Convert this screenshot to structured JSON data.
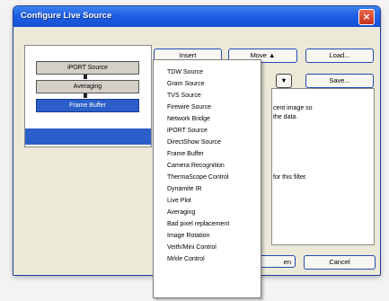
{
  "window": {
    "title": "Configure Live Source",
    "close_label": "×"
  },
  "chain": [
    {
      "label": "iPORT Source",
      "selected": false
    },
    {
      "label": "Averaging",
      "selected": false
    },
    {
      "label": "Frame Buffer",
      "selected": true
    }
  ],
  "buttons": {
    "insert": "Insert",
    "move_up": "Move ▲",
    "load": "Load...",
    "move_down": "▼",
    "save": "Save...",
    "open": "en",
    "cancel": "Cancel"
  },
  "description_fragments": [
    "cent image so",
    "the data.",
    "for this filter."
  ],
  "insert_menu": [
    "TDW Source",
    "Gram Source",
    "TVS Source",
    "Firewire Source",
    "Network Bridge",
    "iPORT Source",
    "DirectShow Source",
    "Frame Buffer",
    "Camera Recognition",
    "ThermaScope Control",
    "Dynamite IR",
    "Live Plot",
    "Averaging",
    "Bad pixel replacement",
    "Image Rotation",
    "Veith/Mini Control",
    "Mrkle Control"
  ]
}
